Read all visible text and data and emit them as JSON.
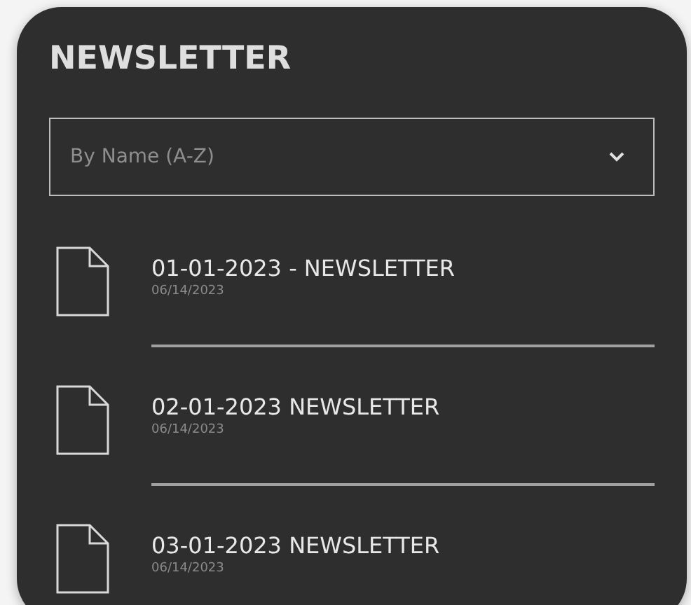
{
  "title": "NEWSLETTER",
  "sort_dropdown": {
    "value": "By Name (A-Z)"
  },
  "items": [
    {
      "name": "01-01-2023 - NEWSLETTER",
      "date": "06/14/2023"
    },
    {
      "name": "02-01-2023 NEWSLETTER",
      "date": "06/14/2023"
    },
    {
      "name": "03-01-2023 NEWSLETTER",
      "date": "06/14/2023"
    }
  ]
}
